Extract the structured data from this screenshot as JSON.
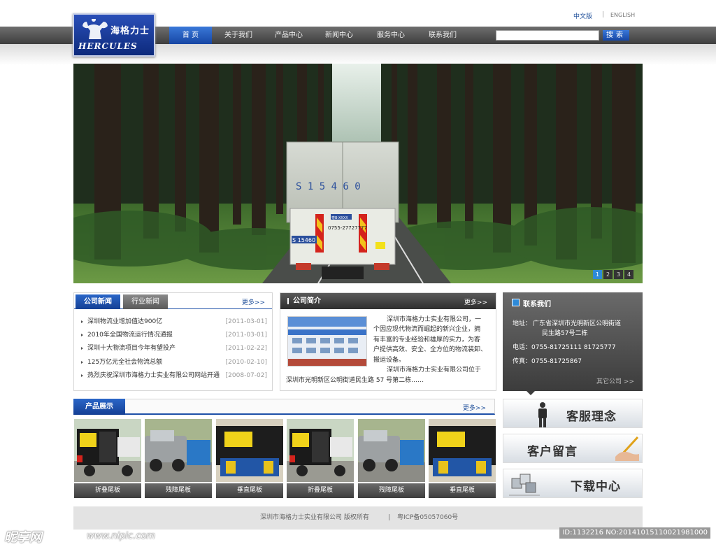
{
  "header": {
    "logo": {
      "cn": "海格力士",
      "en": "HERCULES"
    },
    "lang": {
      "zh": "中文版",
      "separator": "|",
      "en": "ENGLISH"
    },
    "nav": [
      "首 页",
      "关于我们",
      "产品中心",
      "新闻中心",
      "服务中心",
      "联系我们"
    ],
    "search": {
      "value": "",
      "button": "搜索"
    }
  },
  "banner": {
    "truck_side_text": "S 1 5 4 6 0",
    "plate_top": "粤B-XXXX",
    "phone": "0755-27727777",
    "plate": "S 15460",
    "pages": [
      "1",
      "2",
      "3",
      "4"
    ],
    "active_page": 0
  },
  "news": {
    "tabs": [
      "公司新闻",
      "行业新闻"
    ],
    "more": "更多>>",
    "items": [
      {
        "title": "深圳物流业增加值达900亿",
        "date": "[2011-03-01]"
      },
      {
        "title": "2010年全国物流运行情况通报",
        "date": "[2011-03-01]"
      },
      {
        "title": "深圳十大物流项目今年有望投产",
        "date": "[2011-02-22]"
      },
      {
        "title": "125万亿元全社会物流总额",
        "date": "[2010-02-10]"
      },
      {
        "title": "热烈庆祝深圳市海格力士实业有限公司网站开通",
        "date": "[2008-07-02]"
      }
    ]
  },
  "about": {
    "title": "公司简介",
    "more": "更多>>",
    "lines": [
      "深圳市海格力士实业有限公司，一",
      "个因应现代物流而崛起的新兴企业，拥",
      "有丰富的专业经验和雄厚的实力，为客",
      "户提供高效、安全、全方位的物流装卸、",
      "搬运设备。",
      "深圳市海格力士实业有限公司位于"
    ],
    "last_line": "深圳市光明新区公明街道民生路 57 号第二栋……"
  },
  "contact": {
    "title": "联系我们",
    "address_label": "地址：",
    "address_1": "广东省深圳市光明新区公明街道",
    "address_2": "民生路57号二栋",
    "phone": "电话：0755-81725111 81725777",
    "fax": "传真：0755-81725867",
    "more": "其它公司 >>"
  },
  "products": {
    "title": "产品展示",
    "more": "更多>>",
    "items": [
      "折叠尾板",
      "残障尾板",
      "垂直尾板",
      "折叠尾板",
      "残障尾板",
      "垂直尾板"
    ]
  },
  "side_buttons": [
    "客服理念",
    "客户留言",
    "下载中心"
  ],
  "footer": {
    "copyright": "深圳市海格力士实业有限公司  版权所有",
    "separator": "|",
    "icp": "粤ICP备05057060号"
  },
  "watermark": {
    "brand": "昵享网",
    "url": "www.nipic.com",
    "id": "ID:1132216 NO:20141015110021981000"
  },
  "colors": {
    "accent": "#1e50a8",
    "nav_dark": "#3e3e3e",
    "active_page": "#2e8ad8"
  }
}
